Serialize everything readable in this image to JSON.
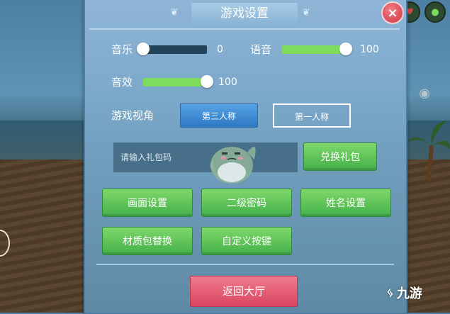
{
  "dialog": {
    "title": "游戏设置",
    "close_icon": "×"
  },
  "audio": {
    "music_label": "音乐",
    "music_value": "0",
    "music_level": 0,
    "voice_label": "语音",
    "voice_value": "100",
    "voice_level": 1,
    "sfx_label": "音效",
    "sfx_value": "100",
    "sfx_level": 1
  },
  "view": {
    "label": "游戏视角",
    "third_person": "第三人称",
    "first_person": "第一人称",
    "selected": "第三人称"
  },
  "gift": {
    "placeholder": "请输入礼包码",
    "redeem_label": "兑换礼包"
  },
  "settings_buttons": {
    "graphics": "画面设置",
    "second_password": "二级密码",
    "name_settings": "姓名设置",
    "texture_pack": "材质包替换",
    "custom_keys": "自定义按键"
  },
  "footer": {
    "back_label": "返回大厅"
  },
  "watermark": {
    "text": "九游"
  },
  "colors": {
    "accent_green": "#7ddc5c",
    "accent_blue": "#2f78c4",
    "back_red": "#d94660"
  }
}
